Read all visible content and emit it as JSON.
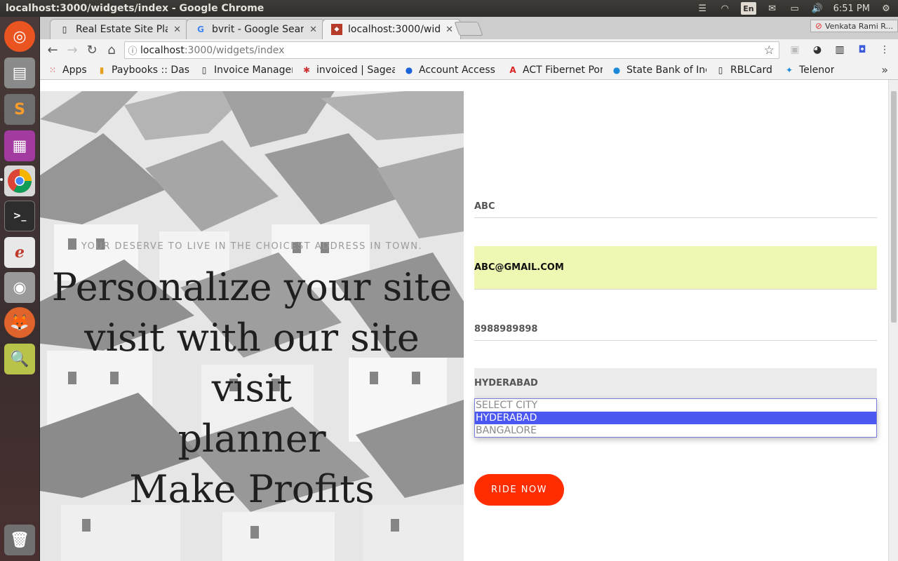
{
  "window": {
    "title": "localhost:3000/widgets/index - Google Chrome"
  },
  "indicators": {
    "lang": "En",
    "time": "6:51 PM"
  },
  "profile": {
    "name": "Venkata Rami R..."
  },
  "tabs": [
    {
      "label": "Real Estate Site Pla",
      "favicon": "doc-icon"
    },
    {
      "label": "bvrit - Google Searc",
      "favicon": "google-icon"
    },
    {
      "label": "localhost:3000/wid",
      "favicon": "site-icon"
    }
  ],
  "omnibox": {
    "host": "localhost",
    "path": ":3000/widgets/index"
  },
  "bookmarks": [
    {
      "label": "Apps"
    },
    {
      "label": "Paybooks :: Dash"
    },
    {
      "label": "Invoice Manager"
    },
    {
      "label": "invoiced | Sageal"
    },
    {
      "label": "Account Access -"
    },
    {
      "label": "ACT Fibernet Por"
    },
    {
      "label": "State Bank of Inc"
    },
    {
      "label": "RBLCard"
    },
    {
      "label": "Telenor"
    }
  ],
  "hero": {
    "tagline": "YOUR DESERVE TO LIVE IN THE CHOICEST ADDRESS IN TOWN.",
    "headline_lines": [
      "Personalize your site",
      "visit with our site visit",
      "planner",
      "Make Profits"
    ]
  },
  "form": {
    "name": "ABC",
    "email": "ABC@GMAIL.COM",
    "phone": "8988989898",
    "city_selected": "HYDERABAD",
    "city_options": [
      "SELECT CITY",
      "HYDERABAD",
      "BANGALORE"
    ],
    "submit_label": "RIDE NOW"
  },
  "colors": {
    "accent": "#ff2d00",
    "autofill": "#f0f7b3",
    "option_highlight": "#4a57f0"
  }
}
